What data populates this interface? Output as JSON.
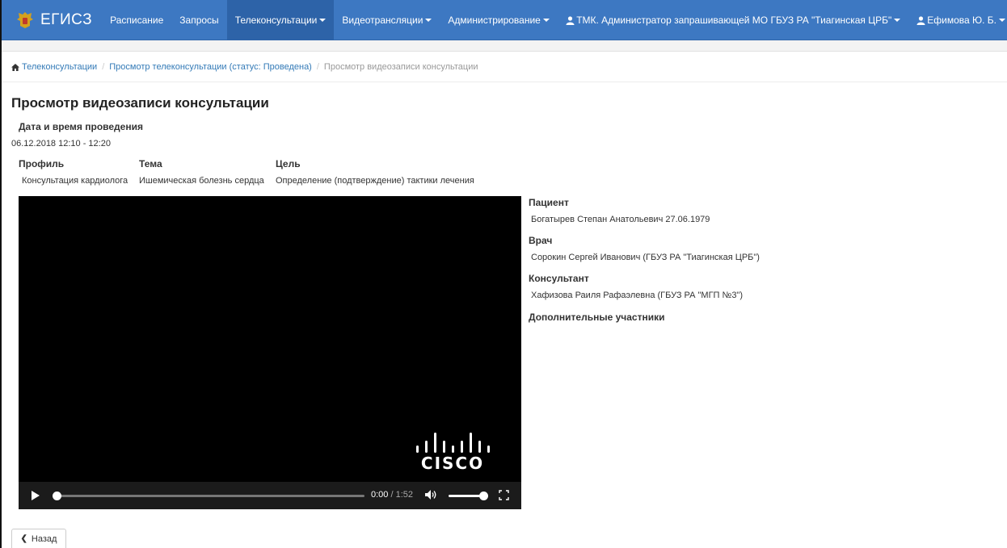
{
  "navbar": {
    "brand": "ЕГИСЗ",
    "items": [
      {
        "label": "Расписание",
        "dropdown": false
      },
      {
        "label": "Запросы",
        "dropdown": false
      },
      {
        "label": "Телеконсультации",
        "dropdown": true,
        "active": true
      },
      {
        "label": "Видеотрансляции",
        "dropdown": true
      },
      {
        "label": "Администрирование",
        "dropdown": true
      }
    ],
    "role": "ТМК. Администратор запрашивающей МО ГБУЗ РА \"Тиагинская ЦРБ\"",
    "user": "Ефимова Ю. Б.",
    "colors": {
      "bar": "#3d78c2",
      "active": "#2d63a8"
    }
  },
  "breadcrumb": {
    "items": [
      "Телеконсультации",
      "Просмотр телеконсультации (статус: Проведена)",
      "Просмотр видеозаписи консультации"
    ]
  },
  "page": {
    "title": "Просмотр видеозаписи консультации",
    "datetime_label": "Дата и время проведения",
    "datetime_value": "06.12.2018 12:10 - 12:20",
    "profile_label": "Профиль",
    "profile_value": "Консультация кардиолога",
    "topic_label": "Тема",
    "topic_value": "Ишемическая болезнь сердца",
    "goal_label": "Цель",
    "goal_value": "Определение (подтверждение) тактики лечения"
  },
  "participants": {
    "patient_label": "Пациент",
    "patient_value": "Богатырев Степан Анатольевич 27.06.1979",
    "doctor_label": "Врач",
    "doctor_value": "Сорокин Сергей Иванович (ГБУЗ РА \"Тиагинская ЦРБ\")",
    "consultant_label": "Консультант",
    "consultant_value": "Хафизова Раиля Рафаэлевна (ГБУЗ РА \"МГП №3\")",
    "extra_label": "Дополнительные участники"
  },
  "video": {
    "logo_text": "CISCO",
    "current_time": "0:00",
    "duration": "1:52",
    "progress": 0,
    "volume": 1
  },
  "back_button": "Назад"
}
